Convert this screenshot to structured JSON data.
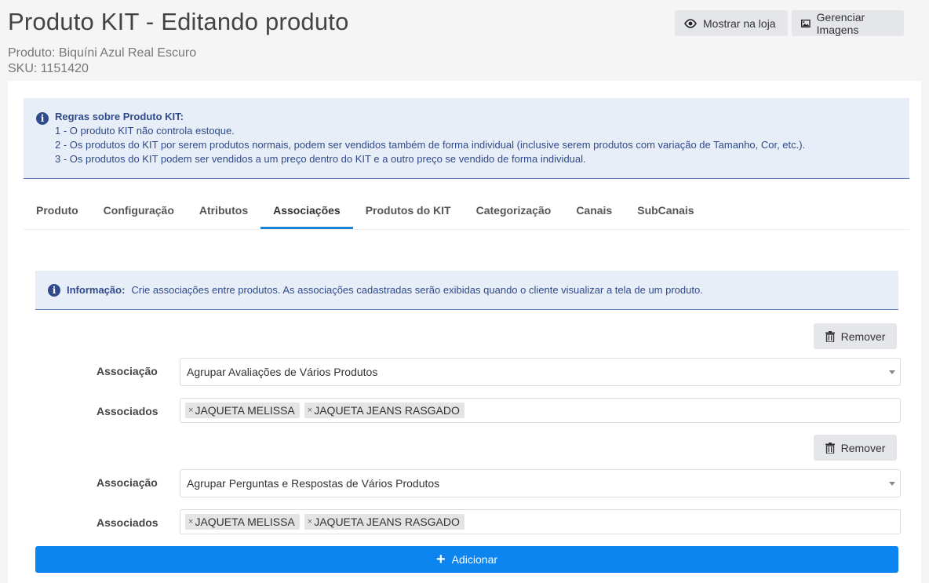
{
  "header": {
    "title": "Produto KIT - Editando produto",
    "product_line": "Produto: Biquíni Azul Real Escuro",
    "sku_line": "SKU: 1151420",
    "show_store_label": "Mostrar na loja",
    "manage_images_label": "Gerenciar Imagens"
  },
  "rules": {
    "title": "Regras sobre Produto KIT:",
    "lines": [
      "1 - O produto KIT não controla estoque.",
      "2 - Os produtos do KIT por serem produtos normais, podem ser vendidos também de forma individual (inclusive serem produtos com variação de Tamanho, Cor, etc.).",
      "3 - Os produtos do KIT podem ser vendidos a um preço dentro do KIT e a outro preço se vendido de forma individual."
    ]
  },
  "tabs": [
    {
      "label": "Produto"
    },
    {
      "label": "Configuração"
    },
    {
      "label": "Atributos"
    },
    {
      "label": "Associações",
      "active": true
    },
    {
      "label": "Produtos do KIT"
    },
    {
      "label": "Categorização"
    },
    {
      "label": "Canais"
    },
    {
      "label": "SubCanais"
    }
  ],
  "info": {
    "label": "Informação:",
    "text": "Crie associações entre produtos. As associações cadastradas serão exibidas quando o cliente visualizar a tela de um produto."
  },
  "associations": [
    {
      "remove_label": "Remover",
      "association_label": "Associação",
      "association_value": "Agrupar Avaliações de Vários Produtos",
      "associated_label": "Associados",
      "tags": [
        "JAQUETA MELISSA",
        "JAQUETA JEANS RASGADO"
      ]
    },
    {
      "remove_label": "Remover",
      "association_label": "Associação",
      "association_value": "Agrupar Perguntas e Respostas de Vários Produtos",
      "associated_label": "Associados",
      "tags": [
        "JAQUETA MELISSA",
        "JAQUETA JEANS RASGADO"
      ]
    }
  ],
  "add_label": "Adicionar",
  "icons": {
    "show_store": "eye-icon",
    "manage_images": "image-icon",
    "info": "info-icon",
    "remove": "trash-icon",
    "add": "plus-icon",
    "tag_remove": "close-icon",
    "select": "chevron-down-icon"
  },
  "colors": {
    "accent": "#0d85f0",
    "tab_active": "#1a84d9",
    "info_bg": "#e8eef8",
    "info_text": "#2f4a8a"
  }
}
